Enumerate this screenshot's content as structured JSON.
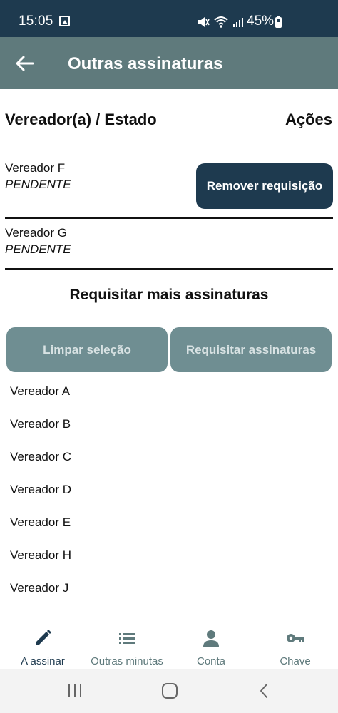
{
  "status_bar": {
    "time": "15:05",
    "battery": "45%",
    "icons": [
      "gallery-icon",
      "mute-icon",
      "wifi-icon",
      "signal-icon",
      "battery-icon"
    ]
  },
  "app_bar": {
    "title": "Outras assinaturas",
    "back_icon": "back-arrow-icon"
  },
  "table_header": {
    "left": "Vereador(a) / Estado",
    "right": "Ações"
  },
  "requests": [
    {
      "name": "Vereador F",
      "status": "PENDENTE",
      "action": "Remover requisição"
    },
    {
      "name": "Vereador G",
      "status": "PENDENTE"
    }
  ],
  "request_more": {
    "title": "Requisitar mais assinaturas",
    "clear_label": "Limpar seleção",
    "request_label": "Requisitar assinaturas"
  },
  "vereadores": [
    "Vereador A",
    "Vereador B",
    "Vereador C",
    "Vereador D",
    "Vereador E",
    "Vereador H",
    "Vereador J"
  ],
  "bottom_nav": [
    {
      "label": "A assinar",
      "icon": "pen-icon",
      "active": true
    },
    {
      "label": "Outras minutas",
      "icon": "list-icon",
      "active": false
    },
    {
      "label": "Conta",
      "icon": "person-icon",
      "active": false
    },
    {
      "label": "Chave",
      "icon": "key-icon",
      "active": false
    }
  ],
  "colors": {
    "primary": "#1e3a4f",
    "app_bar": "#5f7a7c",
    "disabled_button": "#6f8e92"
  }
}
